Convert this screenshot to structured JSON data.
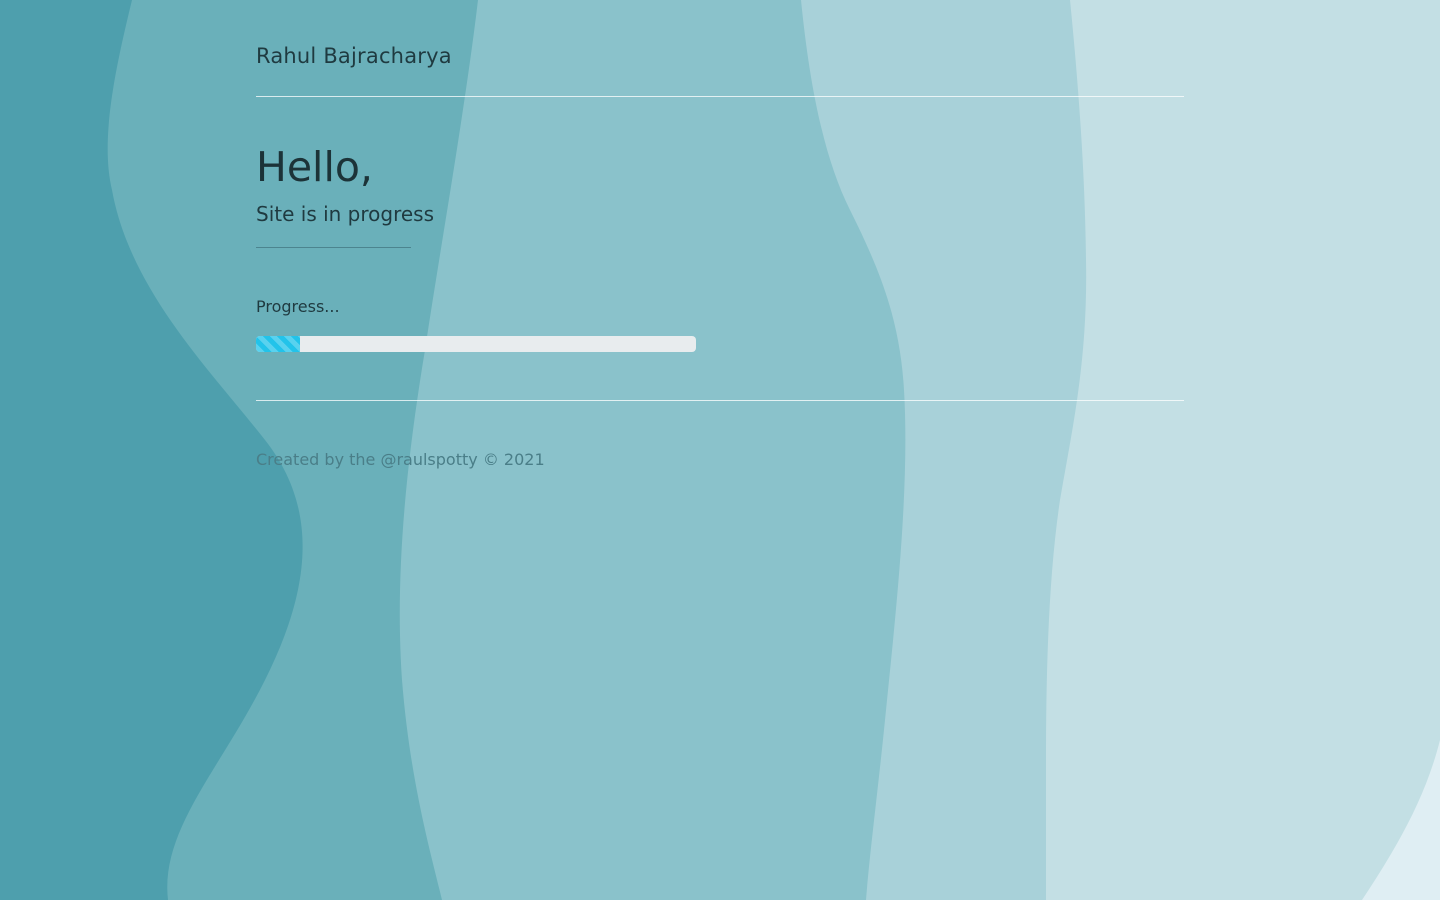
{
  "header": {
    "brand": "Rahul Bajracharya"
  },
  "hero": {
    "greeting": "Hello,",
    "subtitle": "Site is in progress"
  },
  "progress": {
    "label": "Progress...",
    "value_percent": 10,
    "color": "#22c3ea"
  },
  "footer": {
    "text": "Created by the @raulspotty © 2021"
  },
  "colors": {
    "wave_darkest": "#4e9fad",
    "wave_dark": "#6ab0ba",
    "wave_mid": "#8ac2cb",
    "wave_light": "#a8d1d9",
    "wave_lighter": "#c3dfe4",
    "wave_lightest": "#dfeef3"
  }
}
